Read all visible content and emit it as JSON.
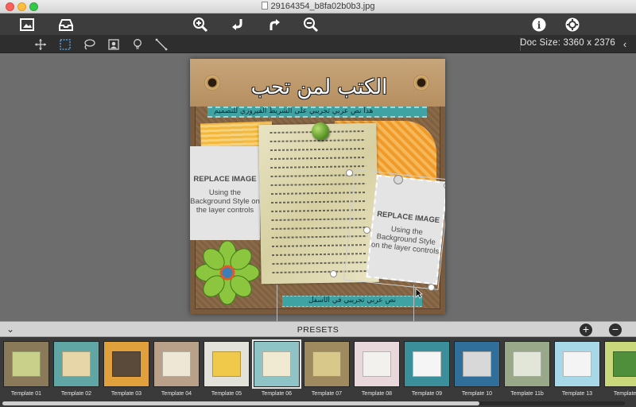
{
  "window": {
    "title": "29164354_b8fa02b0b3.jpg"
  },
  "toolbar": {
    "buttons": [
      {
        "name": "image-icon"
      },
      {
        "name": "export-tray-icon"
      },
      {
        "name": "zoom-in-icon"
      },
      {
        "name": "undo-icon"
      },
      {
        "name": "redo-icon"
      },
      {
        "name": "zoom-out-icon"
      },
      {
        "name": "info-icon"
      },
      {
        "name": "settings-icon"
      }
    ]
  },
  "tools": {
    "items": [
      {
        "name": "move-tool-icon"
      },
      {
        "name": "rect-select-tool-icon"
      },
      {
        "name": "lasso-tool-icon"
      },
      {
        "name": "portrait-tool-icon"
      },
      {
        "name": "bulb-tool-icon"
      },
      {
        "name": "line-tool-icon"
      }
    ],
    "doc_size": "Doc Size: 3360 x 2376"
  },
  "canvas": {
    "banner_title": "الكتب لمن تحب",
    "ribbon_text": "هذا نص عربي تجريبي على الشريط الفيروزي للتصميم",
    "placeholder_left": {
      "heading": "REPLACE IMAGE",
      "body": "Using the Background Style on the layer controls"
    },
    "placeholder_right": {
      "heading": "REPLACE IMAGE",
      "body": "Using the Background Style on the layer controls"
    },
    "bottom_ribbon_text": "نص عربي تجريبي في الأسفل"
  },
  "presets": {
    "label": "PRESETS",
    "add": "+",
    "remove": "−",
    "templates": [
      {
        "label": "Template 01",
        "color": "#8a7a5a",
        "accent": "#c9d08a"
      },
      {
        "label": "Template 02",
        "color": "#5fa6a4",
        "accent": "#e7d6a8"
      },
      {
        "label": "Template 03",
        "color": "#e0a03c",
        "accent": "#5a4a3a"
      },
      {
        "label": "Template 04",
        "color": "#b9a089",
        "accent": "#efe7d6"
      },
      {
        "label": "Template 05",
        "color": "#e2e2da",
        "accent": "#f0c94a"
      },
      {
        "label": "Template 06",
        "color": "#8fc4c6",
        "accent": "#f1ead2"
      },
      {
        "label": "Template 07",
        "color": "#9e8a5e",
        "accent": "#d8c98a"
      },
      {
        "label": "Template 08",
        "color": "#e8d8dc",
        "accent": "#f3f1ee"
      },
      {
        "label": "Template 09",
        "color": "#3b8f9a",
        "accent": "#f5f5f5"
      },
      {
        "label": "Template 10",
        "color": "#2f6f9a",
        "accent": "#d8d8d8"
      },
      {
        "label": "Template 11b",
        "color": "#9aa88a",
        "accent": "#e2e6d8"
      },
      {
        "label": "Template 13",
        "color": "#a7d8e8",
        "accent": "#f4f4f4"
      },
      {
        "label": "Template 1",
        "color": "#c8d87a",
        "accent": "#4f8e3a"
      }
    ]
  }
}
